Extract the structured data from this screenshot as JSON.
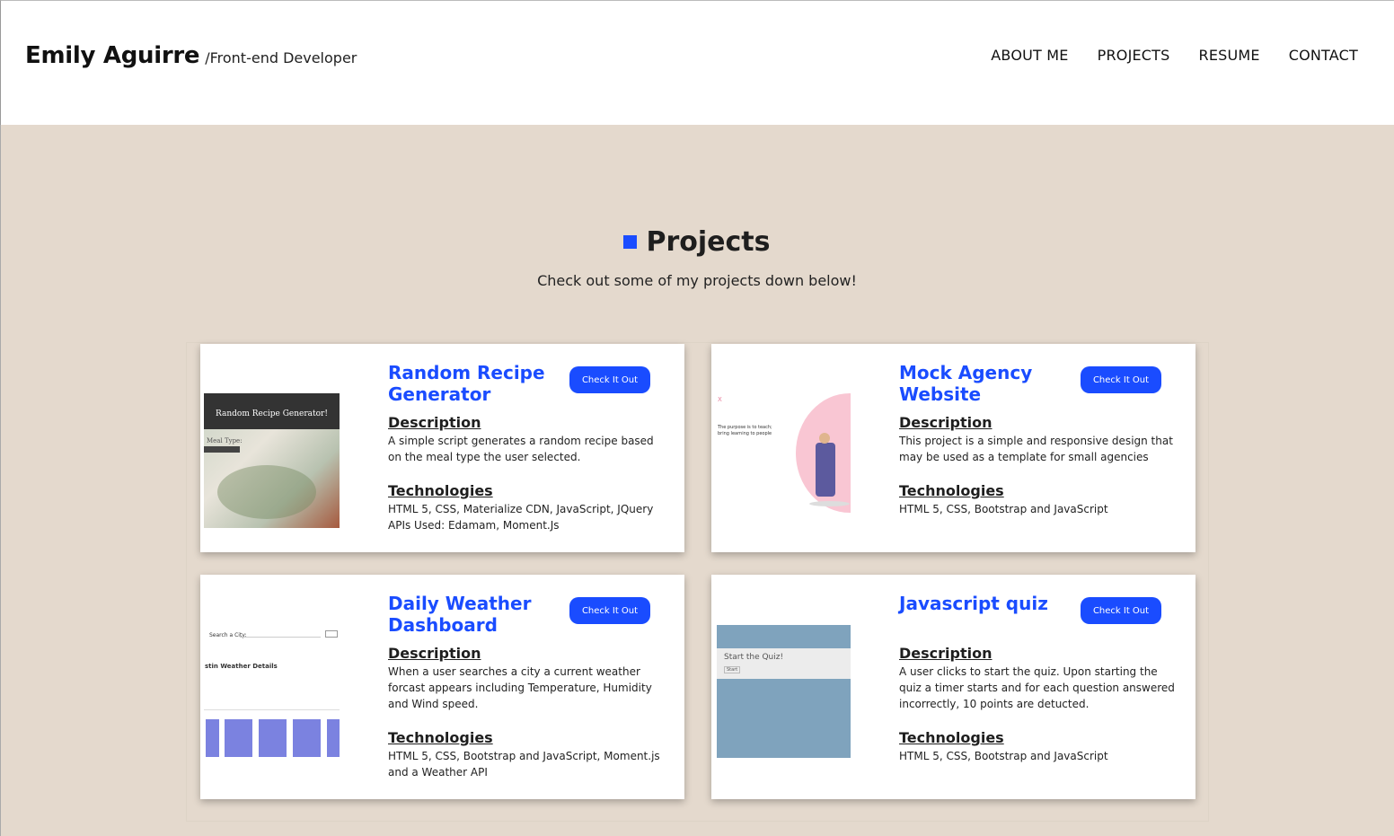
{
  "header": {
    "name": "Emily Aguirre",
    "role": "/Front-end Developer",
    "nav": [
      "ABOUT ME",
      "PROJECTS",
      "RESUME",
      "CONTACT"
    ]
  },
  "section": {
    "title": "Projects",
    "subtitle": "Check out some of my projects down below!"
  },
  "button_label": "Check It Out",
  "desc_heading": "Description",
  "tech_heading": "Technologies",
  "projects": [
    {
      "title": "Random Recipe Generator",
      "description": "A simple script generates a random recipe based on the meal type the user selected.",
      "technologies": "HTML 5, CSS, Materialize CDN, JavaScript, JQuery APIs Used: Edamam, Moment.Js",
      "thumb": {
        "heading": "Random Recipe Generator!",
        "label": "Meal Type:"
      }
    },
    {
      "title": "Mock Agency Website",
      "description": "This project is a simple and responsive design that may be used as a template for small agencies",
      "technologies": "HTML 5, CSS, Bootstrap and JavaScript",
      "thumb": {
        "text": "The purpose is to teach; bring learning to people"
      }
    },
    {
      "title": "Daily Weather Dashboard",
      "description": "When a user searches a city a current weather forcast appears including Temperature, Humidity and Wind speed.",
      "technologies": "HTML 5, CSS, Bootstrap and JavaScript, Moment.js and a Weather API",
      "thumb": {
        "search": "Search a City:",
        "details": "stin Weather Details"
      }
    },
    {
      "title": "Javascript quiz",
      "description": "A user clicks to start the quiz. Upon starting the quiz a timer starts and for each question answered incorrectly, 10 points are detucted.",
      "technologies": "HTML 5, CSS, Bootstrap and JavaScript",
      "thumb": {
        "heading": "Start the Quiz!",
        "button": "Start"
      }
    }
  ],
  "colors": {
    "accent": "#1a4cff",
    "page_bg": "#e4d9cd",
    "header_bg": "#ffffff"
  }
}
